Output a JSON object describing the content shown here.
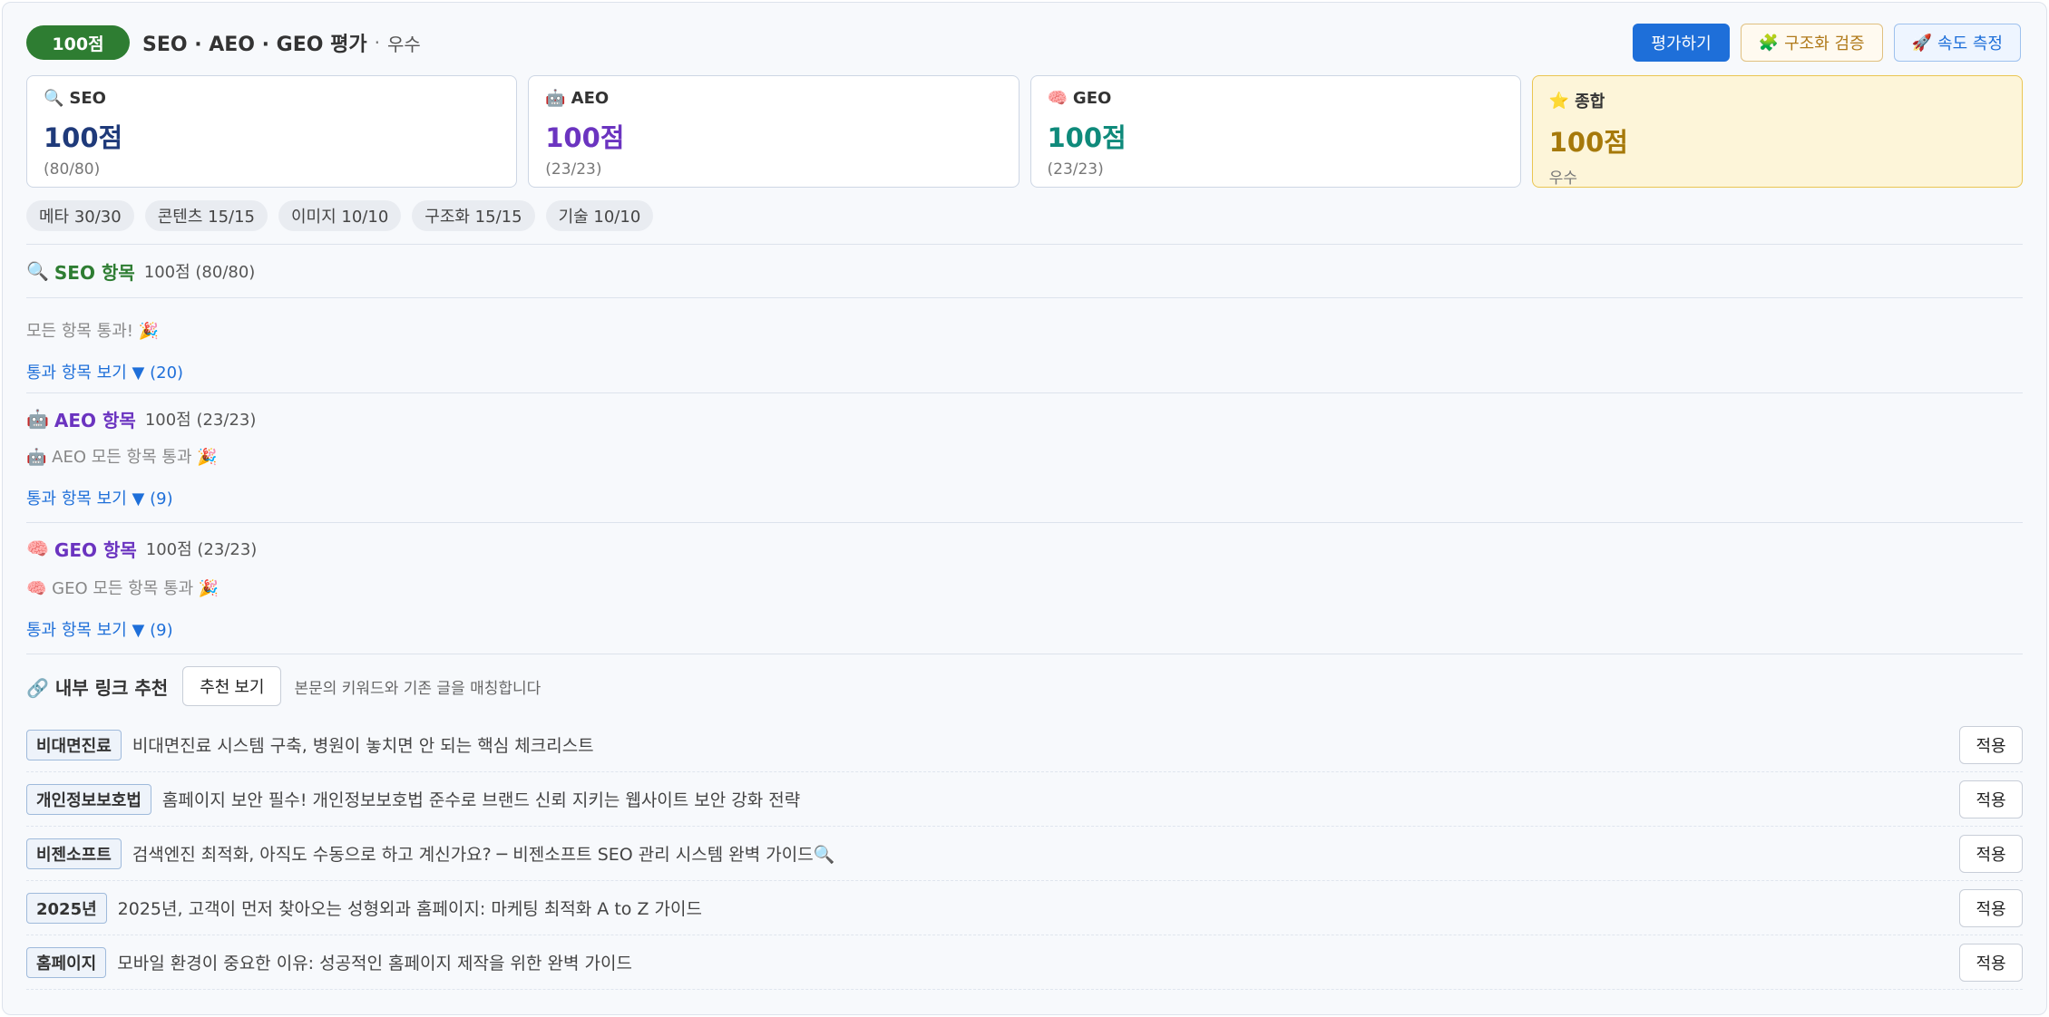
{
  "header": {
    "score_pill": "100점",
    "title": "SEO · AEO · GEO 평가",
    "separator": "·",
    "grade": "우수",
    "actions": {
      "evaluate": "평가하기",
      "struct_check": "구조화 검증",
      "speed_test": "속도 측정"
    }
  },
  "cards": [
    {
      "label": "SEO",
      "icon": "🔍",
      "score": "100점",
      "sub": "(80/80)",
      "color": "#1f3a7a"
    },
    {
      "label": "AEO",
      "icon": "🤖",
      "score": "100점",
      "sub": "(23/23)",
      "color": "#6b34c0"
    },
    {
      "label": "GEO",
      "icon": "🧠",
      "score": "100점",
      "sub": "(23/23)",
      "color": "#0f8a7b"
    },
    {
      "label": "종합",
      "icon": "⭐",
      "score": "100점",
      "sub": "우수",
      "color": "#a6790a"
    }
  ],
  "chips": [
    "메타 30/30",
    "콘텐츠 15/15",
    "이미지 10/10",
    "구조화 15/15",
    "기술 10/10"
  ],
  "sections": {
    "seo": {
      "title": "SEO 항목",
      "icon": "🔍",
      "score": "100점 (80/80)",
      "message": "모든 항목 통과! 🎉",
      "toggle": "통과 항목 보기 ▼ (20)",
      "color": "#2e7d32"
    },
    "aeo": {
      "title": "AEO 항목",
      "icon": "🤖",
      "score": "100점 (23/23)",
      "message": "🤖 AEO 모든 항목 통과 🎉",
      "toggle": "통과 항목 보기 ▼ (9)",
      "color": "#6b34c0"
    },
    "geo": {
      "title": "GEO 항목",
      "icon": "🧠",
      "score": "100점 (23/23)",
      "message": "🧠 GEO 모든 항목 통과 🎉",
      "toggle": "통과 항목 보기 ▼ (9)",
      "color": "#6b34c0"
    }
  },
  "links": {
    "title": "🔗 내부 링크 추천",
    "button": "추천 보기",
    "hint": "본문의 키워드와 기존 글을 매칭합니다",
    "apply_label": "적용",
    "items": [
      {
        "tag": "비대면진료",
        "text": "비대면진료 시스템 구축, 병원이 놓치면 안 되는 핵심 체크리스트"
      },
      {
        "tag": "개인정보보호법",
        "text": "홈페이지 보안 필수! 개인정보보호법 준수로 브랜드 신뢰 지키는 웹사이트 보안 강화 전략"
      },
      {
        "tag": "비젠소프트",
        "text": "검색엔진 최적화, 아직도 수동으로 하고 계신가요? ─ 비젠소프트 SEO 관리 시스템 완벽 가이드🔍"
      },
      {
        "tag": "2025년",
        "text": "2025년, 고객이 먼저 찾아오는 성형외과 홈페이지: 마케팅 최적화 A to Z 가이드"
      },
      {
        "tag": "홈페이지",
        "text": "모바일 환경이 중요한 이유: 성공적인 홈페이지 제작을 위한 완벽 가이드"
      }
    ]
  }
}
